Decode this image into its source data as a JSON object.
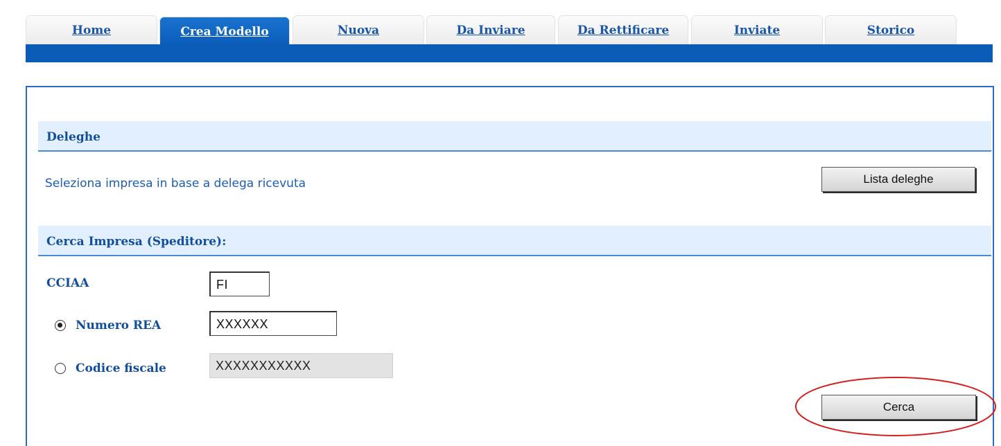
{
  "nav": {
    "tabs": [
      {
        "label": "Home",
        "active": false
      },
      {
        "label": "Crea Modello",
        "active": true
      },
      {
        "label": "Nuova",
        "active": false
      },
      {
        "label": "Da Inviare",
        "active": false
      },
      {
        "label": "Da Rettificare",
        "active": false
      },
      {
        "label": "Inviate",
        "active": false
      },
      {
        "label": "Storico",
        "active": false
      }
    ]
  },
  "deleghe": {
    "title": "Deleghe",
    "description": "Seleziona impresa in base a delega ricevuta",
    "button_label": "Lista deleghe"
  },
  "cerca_impresa": {
    "title": "Cerca Impresa (Speditore):",
    "cciaa_label": "CCIAA",
    "cciaa_value": "FI",
    "numero_rea_label": "Numero REA",
    "numero_rea_value": "XXXXXX",
    "numero_rea_selected": true,
    "codice_fiscale_label": "Codice fiscale",
    "codice_fiscale_value": "XXXXXXXXXXX",
    "codice_fiscale_selected": false,
    "search_button_label": "Cerca"
  },
  "colors": {
    "nav_bar": "#0a5cb6",
    "active_tab": "#0a5cb8",
    "link_text": "#1a56a8",
    "section_bg": "#e1efff",
    "annotation": "#d62020"
  }
}
